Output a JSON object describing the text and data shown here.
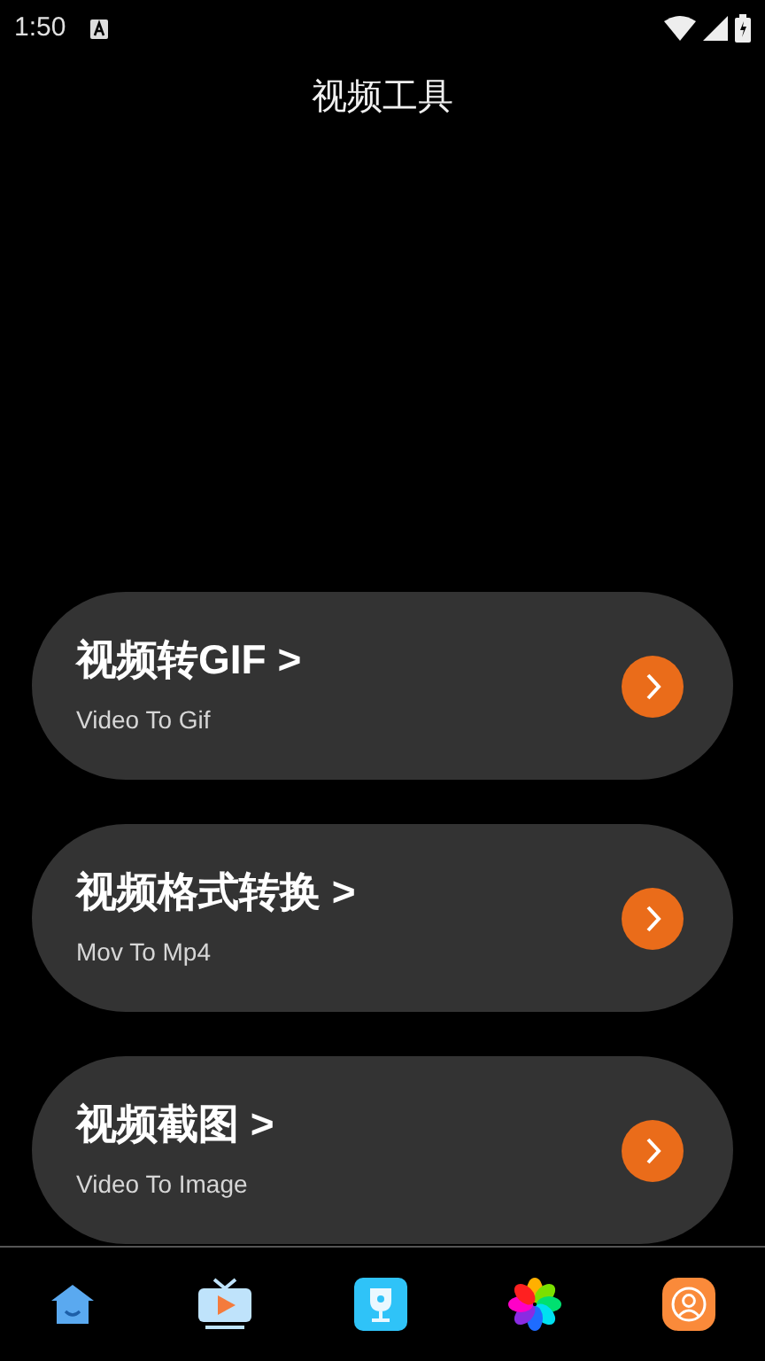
{
  "status_bar": {
    "time": "1:50"
  },
  "title": "视频工具",
  "tools": [
    {
      "title": "视频转GIF >",
      "subtitle": "Video To Gif"
    },
    {
      "title": "视频格式转换 >",
      "subtitle": "Mov To Mp4"
    },
    {
      "title": "视频截图 >",
      "subtitle": "Video To Image"
    }
  ],
  "nav": [
    {
      "kind": "home"
    },
    {
      "kind": "tv"
    },
    {
      "kind": "trophy"
    },
    {
      "kind": "flower"
    },
    {
      "kind": "profile"
    }
  ]
}
